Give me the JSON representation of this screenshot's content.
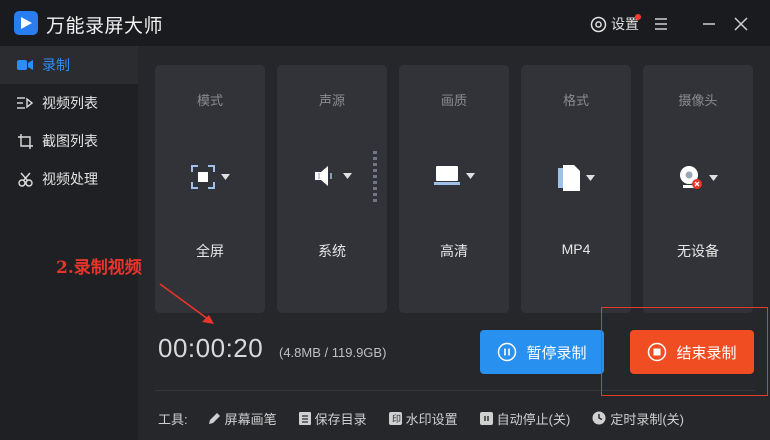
{
  "app": {
    "title": "万能录屏大师",
    "settings_label": "设置"
  },
  "sidebar": {
    "items": [
      {
        "label": "录制",
        "icon": "video-camera-icon",
        "active": true
      },
      {
        "label": "视频列表",
        "icon": "video-list-icon",
        "active": false
      },
      {
        "label": "截图列表",
        "icon": "screenshot-list-icon",
        "active": false
      },
      {
        "label": "视频处理",
        "icon": "video-edit-icon",
        "active": false
      }
    ]
  },
  "cards": [
    {
      "title": "模式",
      "value": "全屏",
      "icon": "fullscreen-icon"
    },
    {
      "title": "声源",
      "value": "系统",
      "icon": "speaker-icon"
    },
    {
      "title": "画质",
      "value": "高清",
      "icon": "monitor-icon"
    },
    {
      "title": "格式",
      "value": "MP4",
      "icon": "file-icon"
    },
    {
      "title": "摄像头",
      "value": "无设备",
      "icon": "webcam-icon"
    }
  ],
  "recording": {
    "timer": "00:00:20",
    "size_info": "(4.8MB / 119.9GB)",
    "pause_label": "暂停录制",
    "stop_label": "结束录制"
  },
  "toolbar": {
    "label": "工具:",
    "items": [
      {
        "label": "屏幕画笔",
        "icon": "pen-icon"
      },
      {
        "label": "保存目录",
        "icon": "folder-icon"
      },
      {
        "label": "水印设置",
        "icon": "watermark-icon"
      },
      {
        "label": "自动停止(关)",
        "icon": "auto-stop-icon"
      },
      {
        "label": "定时录制(关)",
        "icon": "clock-icon"
      }
    ]
  },
  "annotation": {
    "text": "2.录制视频"
  },
  "colors": {
    "accent": "#2e8cf6",
    "pause": "#2891f0",
    "stop": "#f04d23",
    "highlight": "#e43a2a"
  }
}
